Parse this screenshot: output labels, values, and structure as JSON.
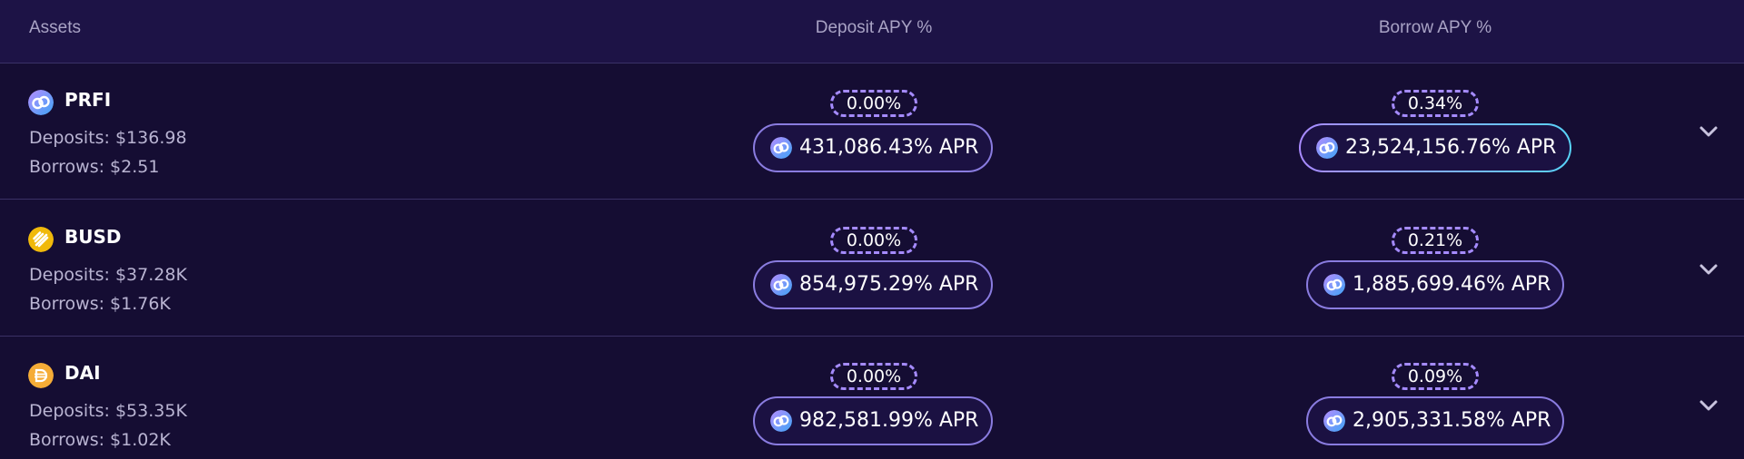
{
  "header": {
    "assets": "Assets",
    "deposit_apy": "Deposit APY %",
    "borrow_apy": "Borrow APY %"
  },
  "rows": [
    {
      "name": "PRFI",
      "icon": "prfi-token-icon",
      "deposits": "Deposits: $136.98",
      "borrows": "Borrows: $2.51",
      "deposit_apy": "0.00%",
      "deposit_apr": "431,086.43% APR",
      "borrow_apy": "0.34%",
      "borrow_apr": "23,524,156.76% APR"
    },
    {
      "name": "BUSD",
      "icon": "busd-token-icon",
      "deposits": "Deposits: $37.28K",
      "borrows": "Borrows: $1.76K",
      "deposit_apy": "0.00%",
      "deposit_apr": "854,975.29% APR",
      "borrow_apy": "0.21%",
      "borrow_apr": "1,885,699.46% APR"
    },
    {
      "name": "DAI",
      "icon": "dai-token-icon",
      "deposits": "Deposits: $53.35K",
      "borrows": "Borrows: $1.02K",
      "deposit_apy": "0.00%",
      "deposit_apr": "982,581.99% APR",
      "borrow_apy": "0.09%",
      "borrow_apr": "2,905,331.58% APR"
    }
  ],
  "colors": {
    "background": "#150d33",
    "header_background": "#1d1346",
    "divider": "#3a3166",
    "apy_dashed_border": "#a58bff",
    "apr_gradient_start": "#a98aff",
    "apr_gradient_end": "#58d3f7",
    "busd_yellow": "#f0b90b",
    "dai_orange": "#f5ac37"
  }
}
